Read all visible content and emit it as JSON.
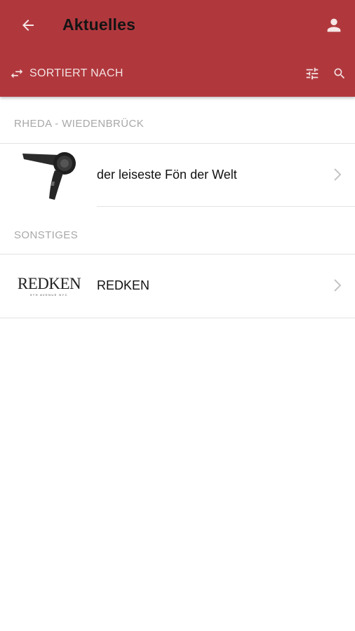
{
  "header": {
    "title": "Aktuelles",
    "bar_color": "#b0383d",
    "back_icon": "arrow-left-icon",
    "profile_icon": "person-icon"
  },
  "toolbar": {
    "sort_label": "SORTIERT NACH",
    "sort_icon": "swap-arrows-icon",
    "filter_icon": "sliders-icon",
    "search_icon": "search-icon"
  },
  "sections": [
    {
      "title": "RHEDA - WIEDENBRÜCK",
      "items": [
        {
          "label": "der leiseste Fön der Welt",
          "thumb": "hair-dryer-image"
        }
      ]
    },
    {
      "title": "SONSTIGES",
      "items": [
        {
          "label": "REDKEN",
          "thumb": "redken-logo",
          "logo_text": "REDKEN",
          "logo_subtext": "5TH AVENUE NYC"
        }
      ]
    }
  ]
}
